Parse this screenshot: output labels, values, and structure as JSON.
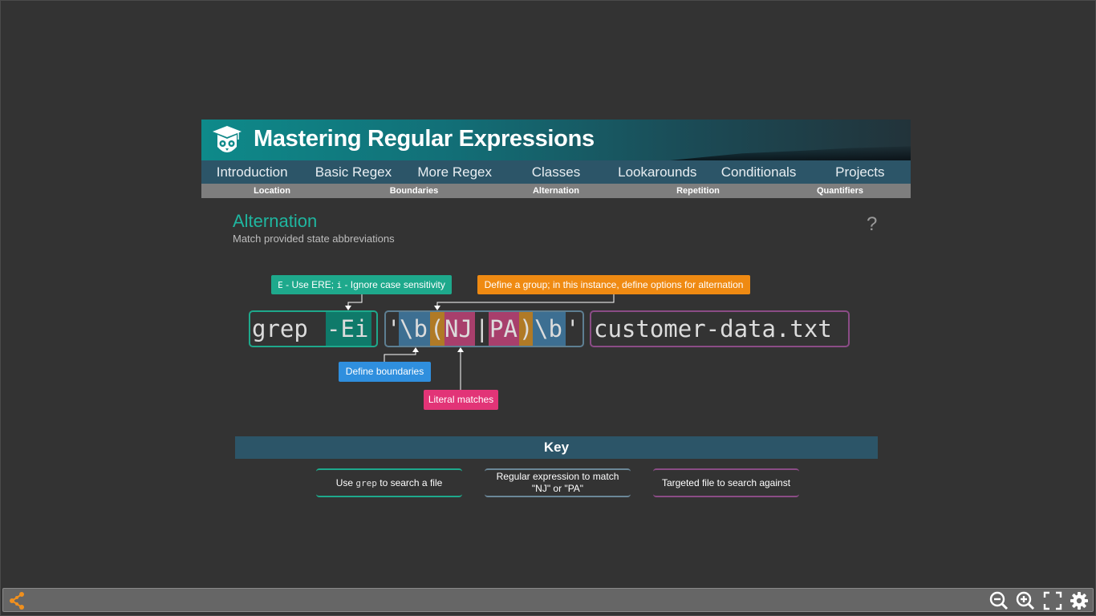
{
  "banner": {
    "title": "Mastering Regular Expressions",
    "logo_icon": "graduation-cap-owl-icon"
  },
  "nav": {
    "items": [
      "Introduction",
      "Basic Regex",
      "More Regex",
      "Classes",
      "Lookarounds",
      "Conditionals",
      "Projects"
    ]
  },
  "subnav": {
    "items": [
      "Location",
      "Boundaries",
      "Alternation",
      "Repetition",
      "Quantifiers"
    ]
  },
  "page": {
    "title": "Alternation",
    "subtitle": "Match provided state abbreviations",
    "help": "?"
  },
  "callouts": {
    "ere_flag": "E",
    "ere_text": " - Use ERE; ",
    "i_flag": "i",
    "i_text": " - Ignore case sensitivity",
    "group": "Define a group; in this instance, define options for alternation",
    "boundaries": "Define boundaries",
    "literal": "Literal matches"
  },
  "command": {
    "grep": "grep",
    "flags": "-Ei",
    "quote_open": "'",
    "b1": "\\b",
    "paren_open": "(",
    "opt1": "NJ",
    "pipe": "|",
    "opt2": "PA",
    "paren_close": ")",
    "b2": "\\b",
    "quote_close": "'",
    "file": "customer-data.txt"
  },
  "key": {
    "title": "Key",
    "grep_pre": "Use ",
    "grep_cmd": "grep",
    "grep_post": " to search a file",
    "regex_line1": "Regular expression to match",
    "regex_line2": "\"NJ\" or \"PA\"",
    "file": "Targeted file to search against"
  },
  "colors": {
    "teal": "#1ea98c",
    "orange": "#ef8a12",
    "blue": "#2f8fde",
    "pink": "#e23477",
    "nav": "#2c5568",
    "title_teal": "#1fb6a0"
  },
  "toolbar": {
    "left_icon": "share-icon",
    "right_icons": [
      "zoom-out-icon",
      "zoom-in-icon",
      "fullscreen-icon",
      "settings-icon"
    ]
  }
}
